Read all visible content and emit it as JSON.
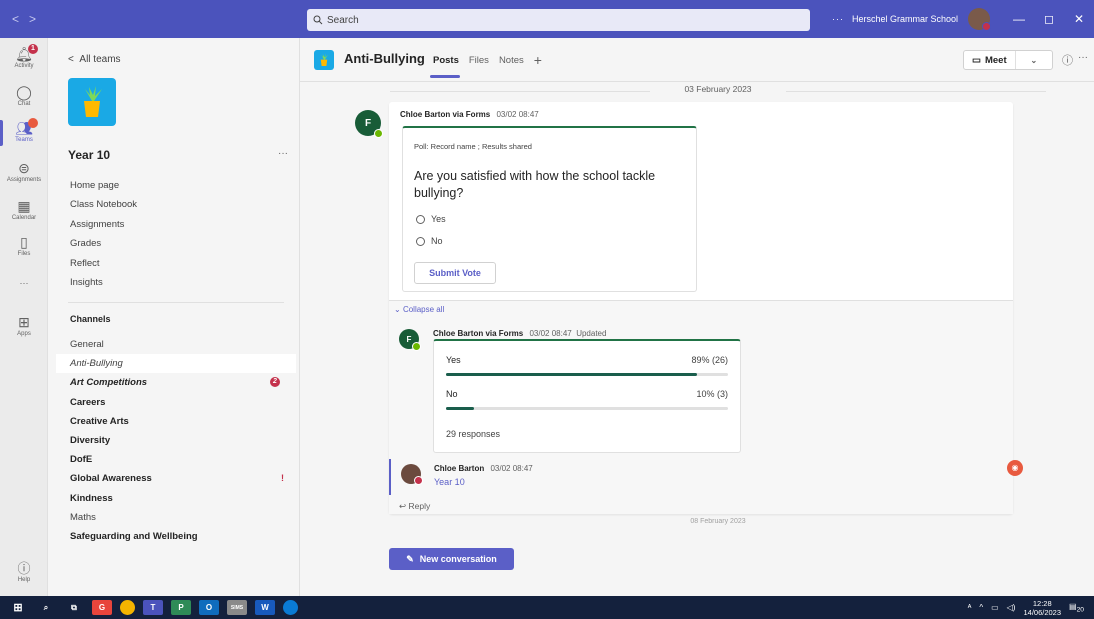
{
  "titlebar": {
    "search_placeholder": "Search",
    "more": "···",
    "org_name": "Herschel Grammar School",
    "minimize": "—",
    "maximize": "◻",
    "close": "✕"
  },
  "rail": {
    "items": [
      {
        "label": "Activity",
        "icon": "bell-icon",
        "badge": "1"
      },
      {
        "label": "Chat",
        "icon": "chat-icon"
      },
      {
        "label": "Teams",
        "icon": "teams-icon",
        "badge": "●"
      },
      {
        "label": "Assignments",
        "icon": "assignments-icon"
      },
      {
        "label": "Calendar",
        "icon": "calendar-icon"
      },
      {
        "label": "Files",
        "icon": "files-icon"
      },
      {
        "label": "···",
        "icon": "more-icon"
      },
      {
        "label": "Apps",
        "icon": "apps-icon"
      }
    ],
    "help_label": "Help"
  },
  "team": {
    "back_label": "All teams",
    "name": "Year 10",
    "more": "···",
    "nav": [
      "Home page",
      "Class Notebook",
      "Assignments",
      "Grades",
      "Reflect",
      "Insights"
    ],
    "channels_heading": "Channels",
    "channels": [
      {
        "name": "General",
        "style": "normal"
      },
      {
        "name": "Anti-Bullying",
        "style": "selected"
      },
      {
        "name": "Art Competitions",
        "style": "bold-italic",
        "badge": "2"
      },
      {
        "name": "Careers",
        "style": "bold"
      },
      {
        "name": "Creative Arts",
        "style": "bold"
      },
      {
        "name": "Diversity",
        "style": "bold"
      },
      {
        "name": "DofE",
        "style": "bold"
      },
      {
        "name": "Global Awareness",
        "style": "bold",
        "pin": true
      },
      {
        "name": "Kindness",
        "style": "bold"
      },
      {
        "name": "Maths",
        "style": "normal"
      },
      {
        "name": "Safeguarding and Wellbeing",
        "style": "bold"
      }
    ]
  },
  "header": {
    "channel_name": "Anti-Bullying",
    "tabs": [
      "Posts",
      "Files",
      "Notes"
    ],
    "add_tab": "+",
    "meet_label": "Meet",
    "meet_chevron": "⌄",
    "info_icon": "ⓘ",
    "more": "···"
  },
  "feed": {
    "date1": "03 February 2023",
    "post": {
      "author": "Chloe Barton via Forms",
      "time": "03/02 08:47",
      "poll_subtitle": "Poll: Record name ; Results shared",
      "question": "Are you satisfied with how the school tackle bullying?",
      "options": [
        "Yes",
        "No"
      ],
      "submit_label": "Submit Vote"
    },
    "collapse_label": "Collapse all",
    "reply1": {
      "author": "Chloe Barton via Forms",
      "time": "03/02 08:47",
      "updated": "Updated",
      "results": [
        {
          "label": "Yes",
          "value": "89% (26)",
          "fraction": 0.89
        },
        {
          "label": "No",
          "value": "10% (3)",
          "fraction": 0.1
        }
      ],
      "responses": "29 responses"
    },
    "reply2": {
      "author": "Chloe Barton",
      "time": "03/02 08:47",
      "mention": "Year 10"
    },
    "reply_label": "Reply",
    "date2": "08 February 2023",
    "new_conversation": "New conversation"
  },
  "taskbar": {
    "time": "12:28",
    "date": "14/06/2023",
    "notifications": "20"
  },
  "colors": {
    "brand": "#4b53bc",
    "accent": "#5b5fc7",
    "forms_green": "#217346"
  }
}
